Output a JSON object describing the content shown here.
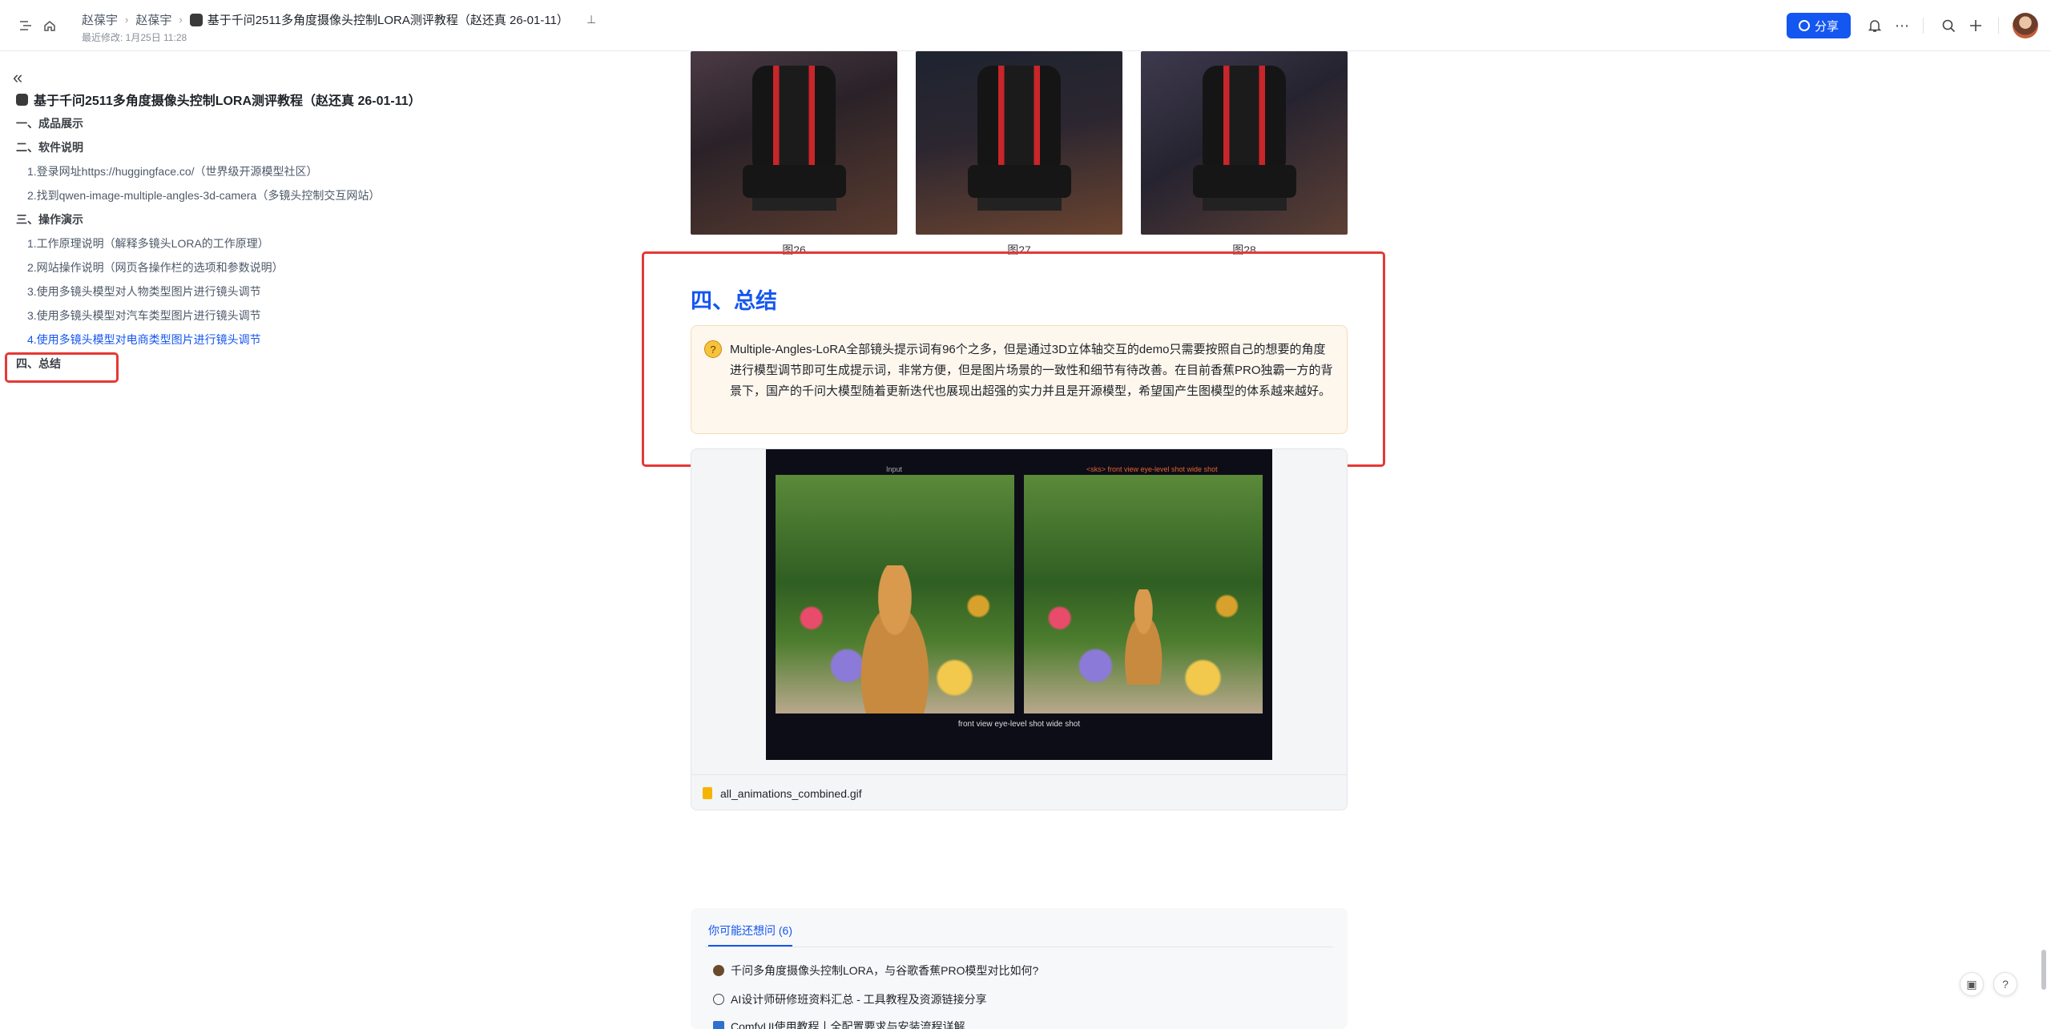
{
  "topbar": {
    "breadcrumbs": [
      "赵葆宇",
      "赵葆宇"
    ],
    "doc_title": "基于千问2511多角度摄像头控制LORA测评教程（赵还真 26-01-11）",
    "last_modified": "最近修改: 1月25日 11:28",
    "share_label": "分享",
    "icons": [
      "menu-icon",
      "home-icon",
      "pin-icon",
      "bell-icon",
      "more-icon",
      "search-icon",
      "plus-icon"
    ]
  },
  "sidebar": {
    "collapse_icon": "double-chevron-left-icon",
    "title": "基于千问2511多角度摄像头控制LORA测评教程（赵还真 26-01-11）",
    "items": [
      {
        "label": "一、成品展示",
        "level": 1
      },
      {
        "label": "二、软件说明",
        "level": 1
      },
      {
        "label": "1.登录网址https://huggingface.co/（世界级开源模型社区）",
        "level": 2
      },
      {
        "label": "2.找到qwen-image-multiple-angles-3d-camera（多镜头控制交互网站）",
        "level": 2
      },
      {
        "label": "三、操作演示",
        "level": 1
      },
      {
        "label": "1.工作原理说明（解释多镜头LORA的工作原理）",
        "level": 2
      },
      {
        "label": "2.网站操作说明（网页各操作栏的选项和参数说明）",
        "level": 2
      },
      {
        "label": "3.使用多镜头模型对人物类型图片进行镜头调节",
        "level": 2
      },
      {
        "label": "3.使用多镜头模型对汽车类型图片进行镜头调节",
        "level": 2
      },
      {
        "label": "4.使用多镜头模型对电商类型图片进行镜头调节",
        "level": 2,
        "active": true
      },
      {
        "label": "四、总结",
        "level": 1,
        "highlighted": true
      }
    ]
  },
  "content": {
    "figures": [
      "图26",
      "图27",
      "图28"
    ],
    "section_heading": "四、总结",
    "callout_emoji": "thinking-face-icon",
    "callout_text": "Multiple-Angles-LoRA全部镜头提示词有96个之多，但是通过3D立体轴交互的demo只需要按照自己的想要的角度进行模型调节即可生成提示词，非常方便，但是图片场景的一致性和细节有待改善。在目前香蕉PRO独霸一方的背景下，国产的千问大模型随着更新迭代也展现出超强的实力并且是开源模型，希望国产生图模型的体系越来越好。",
    "gif": {
      "left_label": "Input",
      "right_label": "<sks> front view eye-level shot wide shot",
      "subtitle": "front view eye-level shot wide shot",
      "filename": "all_animations_combined.gif"
    },
    "related": {
      "tab_label": "你可能还想问 (6)",
      "items": [
        {
          "icon": "avatar-icon",
          "text": "千问多角度摄像头控制LORA，与谷歌香蕉PRO模型对比如何?"
        },
        {
          "icon": "chat-icon",
          "text": "AI设计师研修班资料汇总 - 工具教程及资源链接分享"
        },
        {
          "icon": "book-icon",
          "text": "ComfyUI使用教程丨全配置要求与安装流程详解"
        }
      ]
    }
  },
  "colors": {
    "accent": "#1456f0",
    "highlight_box": "#e53935",
    "callout_bg": "#fef7ee"
  }
}
